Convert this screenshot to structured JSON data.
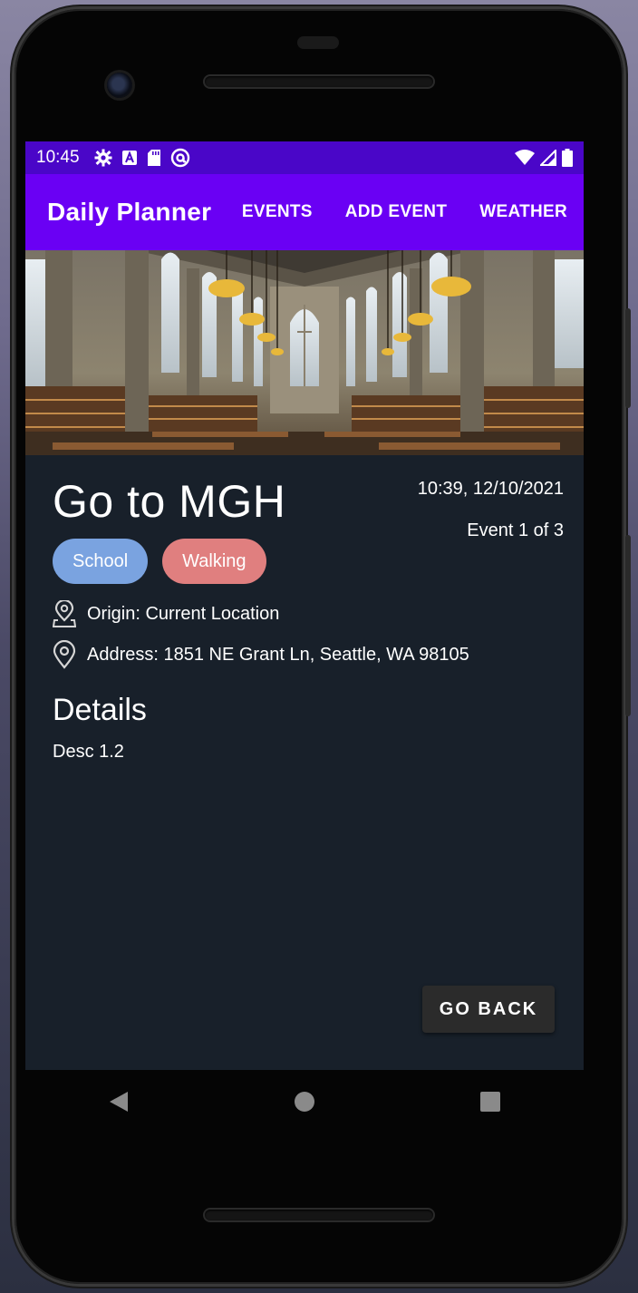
{
  "status_bar": {
    "time": "10:45",
    "left_icons": [
      "gear-icon",
      "font-a-icon",
      "sd-card-icon",
      "at-sign-icon"
    ],
    "right_icons": [
      "wifi-icon",
      "signal-icon",
      "battery-icon"
    ]
  },
  "app_bar": {
    "title": "Daily Planner",
    "nav": [
      "EVENTS",
      "ADD EVENT",
      "WEATHER"
    ],
    "color": "#6a00f4"
  },
  "event": {
    "title": "Go to MGH",
    "datetime": "10:39, 12/10/2021",
    "counter": "Event 1 of 3",
    "tags": [
      {
        "label": "School",
        "color": "#7aa3e0"
      },
      {
        "label": "Walking",
        "color": "#e07f7f"
      }
    ],
    "origin": "Origin: Current Location",
    "address": "Address: 1851 NE Grant Ln, Seattle, WA 98105",
    "details_heading": "Details",
    "description": "Desc 1.2"
  },
  "actions": {
    "go_back": "GO BACK"
  },
  "system_nav": [
    "back-icon",
    "home-icon",
    "recents-icon"
  ]
}
